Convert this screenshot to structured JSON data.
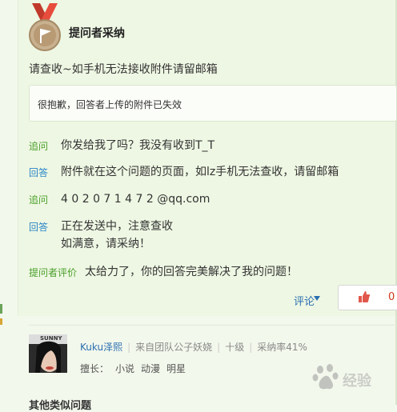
{
  "header": {
    "title": "提问者采纳"
  },
  "question": {
    "text": "请查收~如手机无法接收附件请留邮箱"
  },
  "notice": {
    "text": "很抱歉，回答者上传的附件已失效"
  },
  "thread": [
    {
      "tag": "追问",
      "content": "你发给我了吗？我没有收到T_T"
    },
    {
      "tag": "回答",
      "content": "附件就在这个问题的页面，如lz手机无法查收，请留邮箱"
    },
    {
      "tag": "追问",
      "content": "4 0 2 0 7 1 4 7 2 @qq.com"
    },
    {
      "tag": "回答",
      "lines": [
        "正在发送中，注意查收",
        "如满意，请采纳！"
      ]
    },
    {
      "tag": "提问者评价",
      "content": "太给力了，你的回答完美解决了我的问题！"
    }
  ],
  "actions": {
    "comment_label": "评论",
    "like_count": "0"
  },
  "answerer": {
    "avatar_text": "SUNNY",
    "name": "Kuku泽熙",
    "team": "来自团队公子妖娆",
    "level": "十级",
    "accept_rate": "采纳率41%",
    "specialty_label": "擅长：",
    "specialties": [
      "小说",
      "动漫",
      "明星"
    ]
  },
  "watermark": {
    "text": "经验"
  },
  "related": {
    "heading": "其他类似问题"
  },
  "colors": {
    "tag_blue": "#2a86c8",
    "tag_green": "#4a9f2a",
    "like_red": "#d0361b",
    "panel_bg": "#eef7e3"
  }
}
